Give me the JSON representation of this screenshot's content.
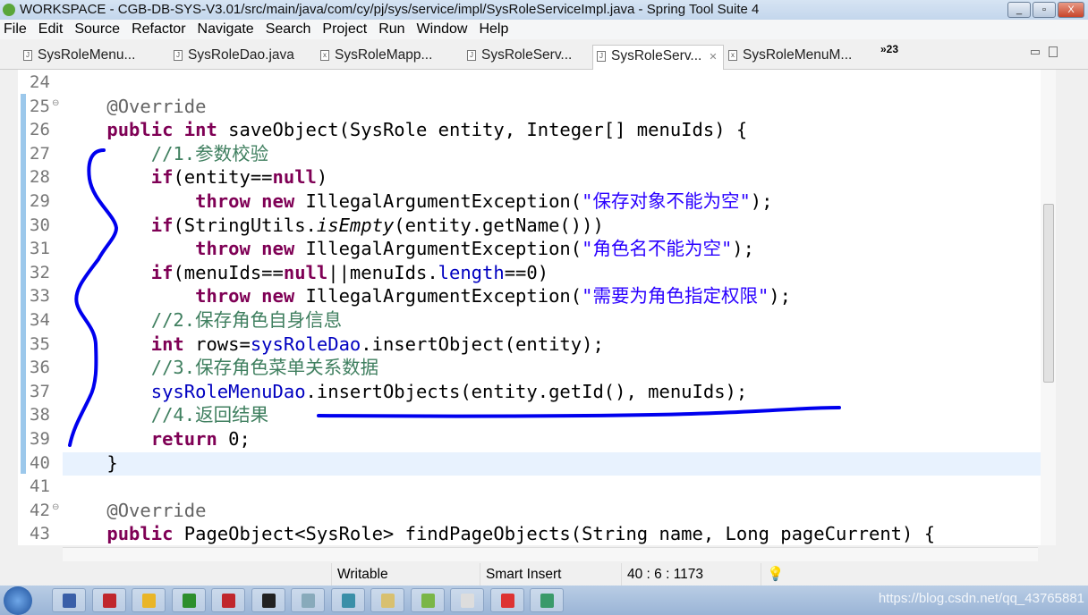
{
  "window": {
    "title": "WORKSPACE - CGB-DB-SYS-V3.01/src/main/java/com/cy/pj/sys/service/impl/SysRoleServiceImpl.java - Spring Tool Suite 4",
    "buttons": [
      "_",
      "▫",
      "X"
    ]
  },
  "menu": [
    "File",
    "Edit",
    "Source",
    "Refactor",
    "Navigate",
    "Search",
    "Project",
    "Run",
    "Window",
    "Help"
  ],
  "tabs": [
    {
      "label": "SysRoleMenu...",
      "icon": "java-file-icon"
    },
    {
      "label": "SysRoleDao.java",
      "icon": "java-file-icon"
    },
    {
      "label": "SysRoleMapp...",
      "icon": "xml-file-icon"
    },
    {
      "label": "SysRoleServ...",
      "icon": "java-file-icon"
    },
    {
      "label": "SysRoleServ...",
      "icon": "java-file-icon",
      "active": true,
      "close": "✕"
    },
    {
      "label": "SysRoleMenuM...",
      "icon": "xml-file-icon"
    }
  ],
  "tabs_overflow": "»23",
  "editor": {
    "current_line": 40,
    "lines": [
      {
        "n": "24",
        "t": []
      },
      {
        "n": "25",
        "fold": "⊖",
        "t": [
          [
            "p",
            "    "
          ],
          [
            "a",
            "@Override"
          ]
        ]
      },
      {
        "n": "26",
        "t": [
          [
            "p",
            "    "
          ],
          [
            "k",
            "public"
          ],
          [
            "p",
            " "
          ],
          [
            "k",
            "int"
          ],
          [
            "p",
            " saveObject(SysRole entity, Integer[] menuIds) {"
          ]
        ]
      },
      {
        "n": "27",
        "t": [
          [
            "p",
            "        "
          ],
          [
            "c",
            "//1.参数校验"
          ]
        ]
      },
      {
        "n": "28",
        "t": [
          [
            "p",
            "        "
          ],
          [
            "k",
            "if"
          ],
          [
            "p",
            "(entity=="
          ],
          [
            "k",
            "null"
          ],
          [
            "p",
            ")"
          ]
        ]
      },
      {
        "n": "29",
        "t": [
          [
            "p",
            "            "
          ],
          [
            "k",
            "throw"
          ],
          [
            "p",
            " "
          ],
          [
            "k",
            "new"
          ],
          [
            "p",
            " IllegalArgumentException("
          ],
          [
            "s",
            "\"保存对象不能为空\""
          ],
          [
            "p",
            ");"
          ]
        ]
      },
      {
        "n": "30",
        "t": [
          [
            "p",
            "        "
          ],
          [
            "k",
            "if"
          ],
          [
            "p",
            "(StringUtils."
          ],
          [
            "i",
            "isEmpty"
          ],
          [
            "p",
            "(entity.getName()))"
          ]
        ]
      },
      {
        "n": "31",
        "t": [
          [
            "p",
            "            "
          ],
          [
            "k",
            "throw"
          ],
          [
            "p",
            " "
          ],
          [
            "k",
            "new"
          ],
          [
            "p",
            " IllegalArgumentException("
          ],
          [
            "s",
            "\"角色名不能为空\""
          ],
          [
            "p",
            ");"
          ]
        ]
      },
      {
        "n": "32",
        "t": [
          [
            "p",
            "        "
          ],
          [
            "k",
            "if"
          ],
          [
            "p",
            "(menuIds=="
          ],
          [
            "k",
            "null"
          ],
          [
            "p",
            "||menuIds."
          ],
          [
            "f",
            "length"
          ],
          [
            "p",
            "==0)"
          ]
        ]
      },
      {
        "n": "33",
        "t": [
          [
            "p",
            "            "
          ],
          [
            "k",
            "throw"
          ],
          [
            "p",
            " "
          ],
          [
            "k",
            "new"
          ],
          [
            "p",
            " IllegalArgumentException("
          ],
          [
            "s",
            "\"需要为角色指定权限\""
          ],
          [
            "p",
            ");"
          ]
        ]
      },
      {
        "n": "34",
        "t": [
          [
            "p",
            "        "
          ],
          [
            "c",
            "//2.保存角色自身信息"
          ]
        ]
      },
      {
        "n": "35",
        "t": [
          [
            "p",
            "        "
          ],
          [
            "k",
            "int"
          ],
          [
            "p",
            " rows="
          ],
          [
            "f",
            "sysRoleDao"
          ],
          [
            "p",
            ".insertObject(entity);"
          ]
        ]
      },
      {
        "n": "36",
        "t": [
          [
            "p",
            "        "
          ],
          [
            "c",
            "//3.保存角色菜单关系数据"
          ]
        ]
      },
      {
        "n": "37",
        "t": [
          [
            "p",
            "        "
          ],
          [
            "f",
            "sysRoleMenuDao"
          ],
          [
            "p",
            ".insertObjects(entity.getId(), menuIds);"
          ]
        ]
      },
      {
        "n": "38",
        "t": [
          [
            "p",
            "        "
          ],
          [
            "c",
            "//4.返回结果"
          ]
        ]
      },
      {
        "n": "39",
        "t": [
          [
            "p",
            "        "
          ],
          [
            "k",
            "return"
          ],
          [
            "p",
            " 0;"
          ]
        ]
      },
      {
        "n": "40",
        "t": [
          [
            "p",
            "    }"
          ]
        ]
      },
      {
        "n": "41",
        "t": []
      },
      {
        "n": "42",
        "fold": "⊖",
        "t": [
          [
            "p",
            "    "
          ],
          [
            "a",
            "@Override"
          ]
        ]
      },
      {
        "n": "43",
        "t": [
          [
            "p",
            "    "
          ],
          [
            "k",
            "public"
          ],
          [
            "p",
            " PageObject<SysRole> findPageObjects(String name, Long pageCurrent) {"
          ]
        ]
      }
    ]
  },
  "status": {
    "mode": "Writable",
    "insert": "Smart Insert",
    "position": "40 : 6 : 1173"
  },
  "taskbar": {
    "watermark": "https://blog.csdn.net/qq_43765881",
    "apps": [
      "#3a5fa8",
      "#c0272d",
      "#e9b528",
      "#2d8f2d",
      "#c0272d",
      "#222",
      "#8ab",
      "#3a8fa8",
      "#d8c070",
      "#7ab648",
      "#ddd",
      "#d33",
      "#3a9a6a"
    ]
  },
  "colors": {
    "keyword": "#7f0055",
    "field": "#0000c0",
    "comment": "#3f7f5f",
    "string": "#2a00ff",
    "ink": "#0000ee"
  }
}
